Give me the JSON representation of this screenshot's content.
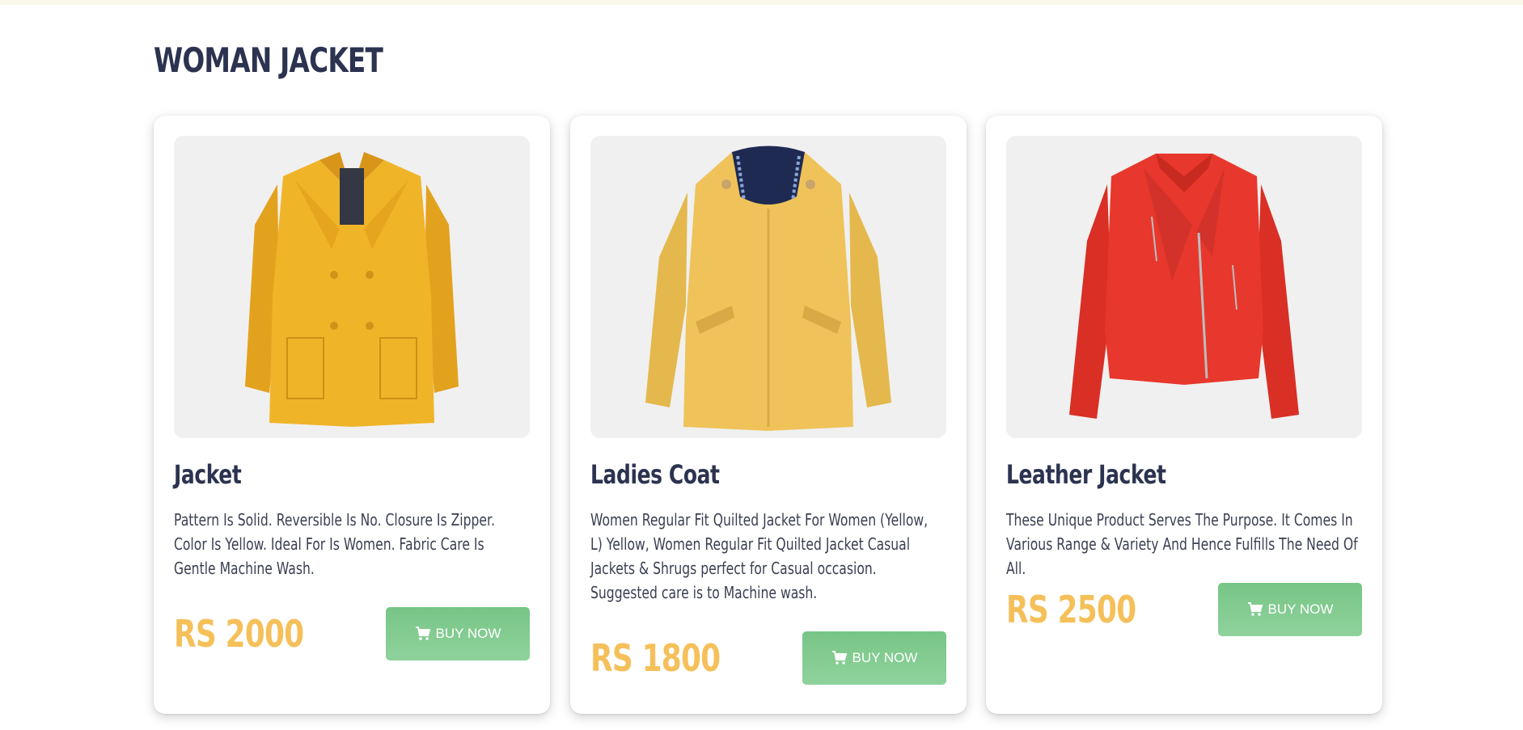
{
  "section": {
    "title": "WOMAN JACKET"
  },
  "products": [
    {
      "name": "Jacket",
      "description": "Pattern Is Solid. Reversible Is No. Closure Is Zipper. Color Is Yellow. Ideal For Is Women. Fabric Care Is Gentle Machine Wash.",
      "price": "RS 2000",
      "button_label": "BUY NOW",
      "image_icon": "yellow-peacoat-image",
      "color": "#f0b429"
    },
    {
      "name": "Ladies Coat",
      "description": "Women Regular Fit Quilted Jacket For Women (Yellow, L) Yellow, Women Regular Fit Quilted Jacket Casual Jackets & Shrugs perfect for Casual occasion. Suggested care is to Machine wash.",
      "price": "RS 1800",
      "button_label": "BUY NOW",
      "image_icon": "yellow-hooded-coat-image",
      "color": "#efc35a"
    },
    {
      "name": "Leather Jacket",
      "description": "These Unique Product Serves The Purpose. It Comes In Various Range & Variety And Hence Fulfills The Need Of All.",
      "price": "RS 2500",
      "button_label": "BUY NOW",
      "image_icon": "red-leather-jacket-image",
      "color": "#e8372c"
    }
  ],
  "colors": {
    "title": "#2c3350",
    "price": "#f5c05a",
    "button": "#7dc98c"
  }
}
